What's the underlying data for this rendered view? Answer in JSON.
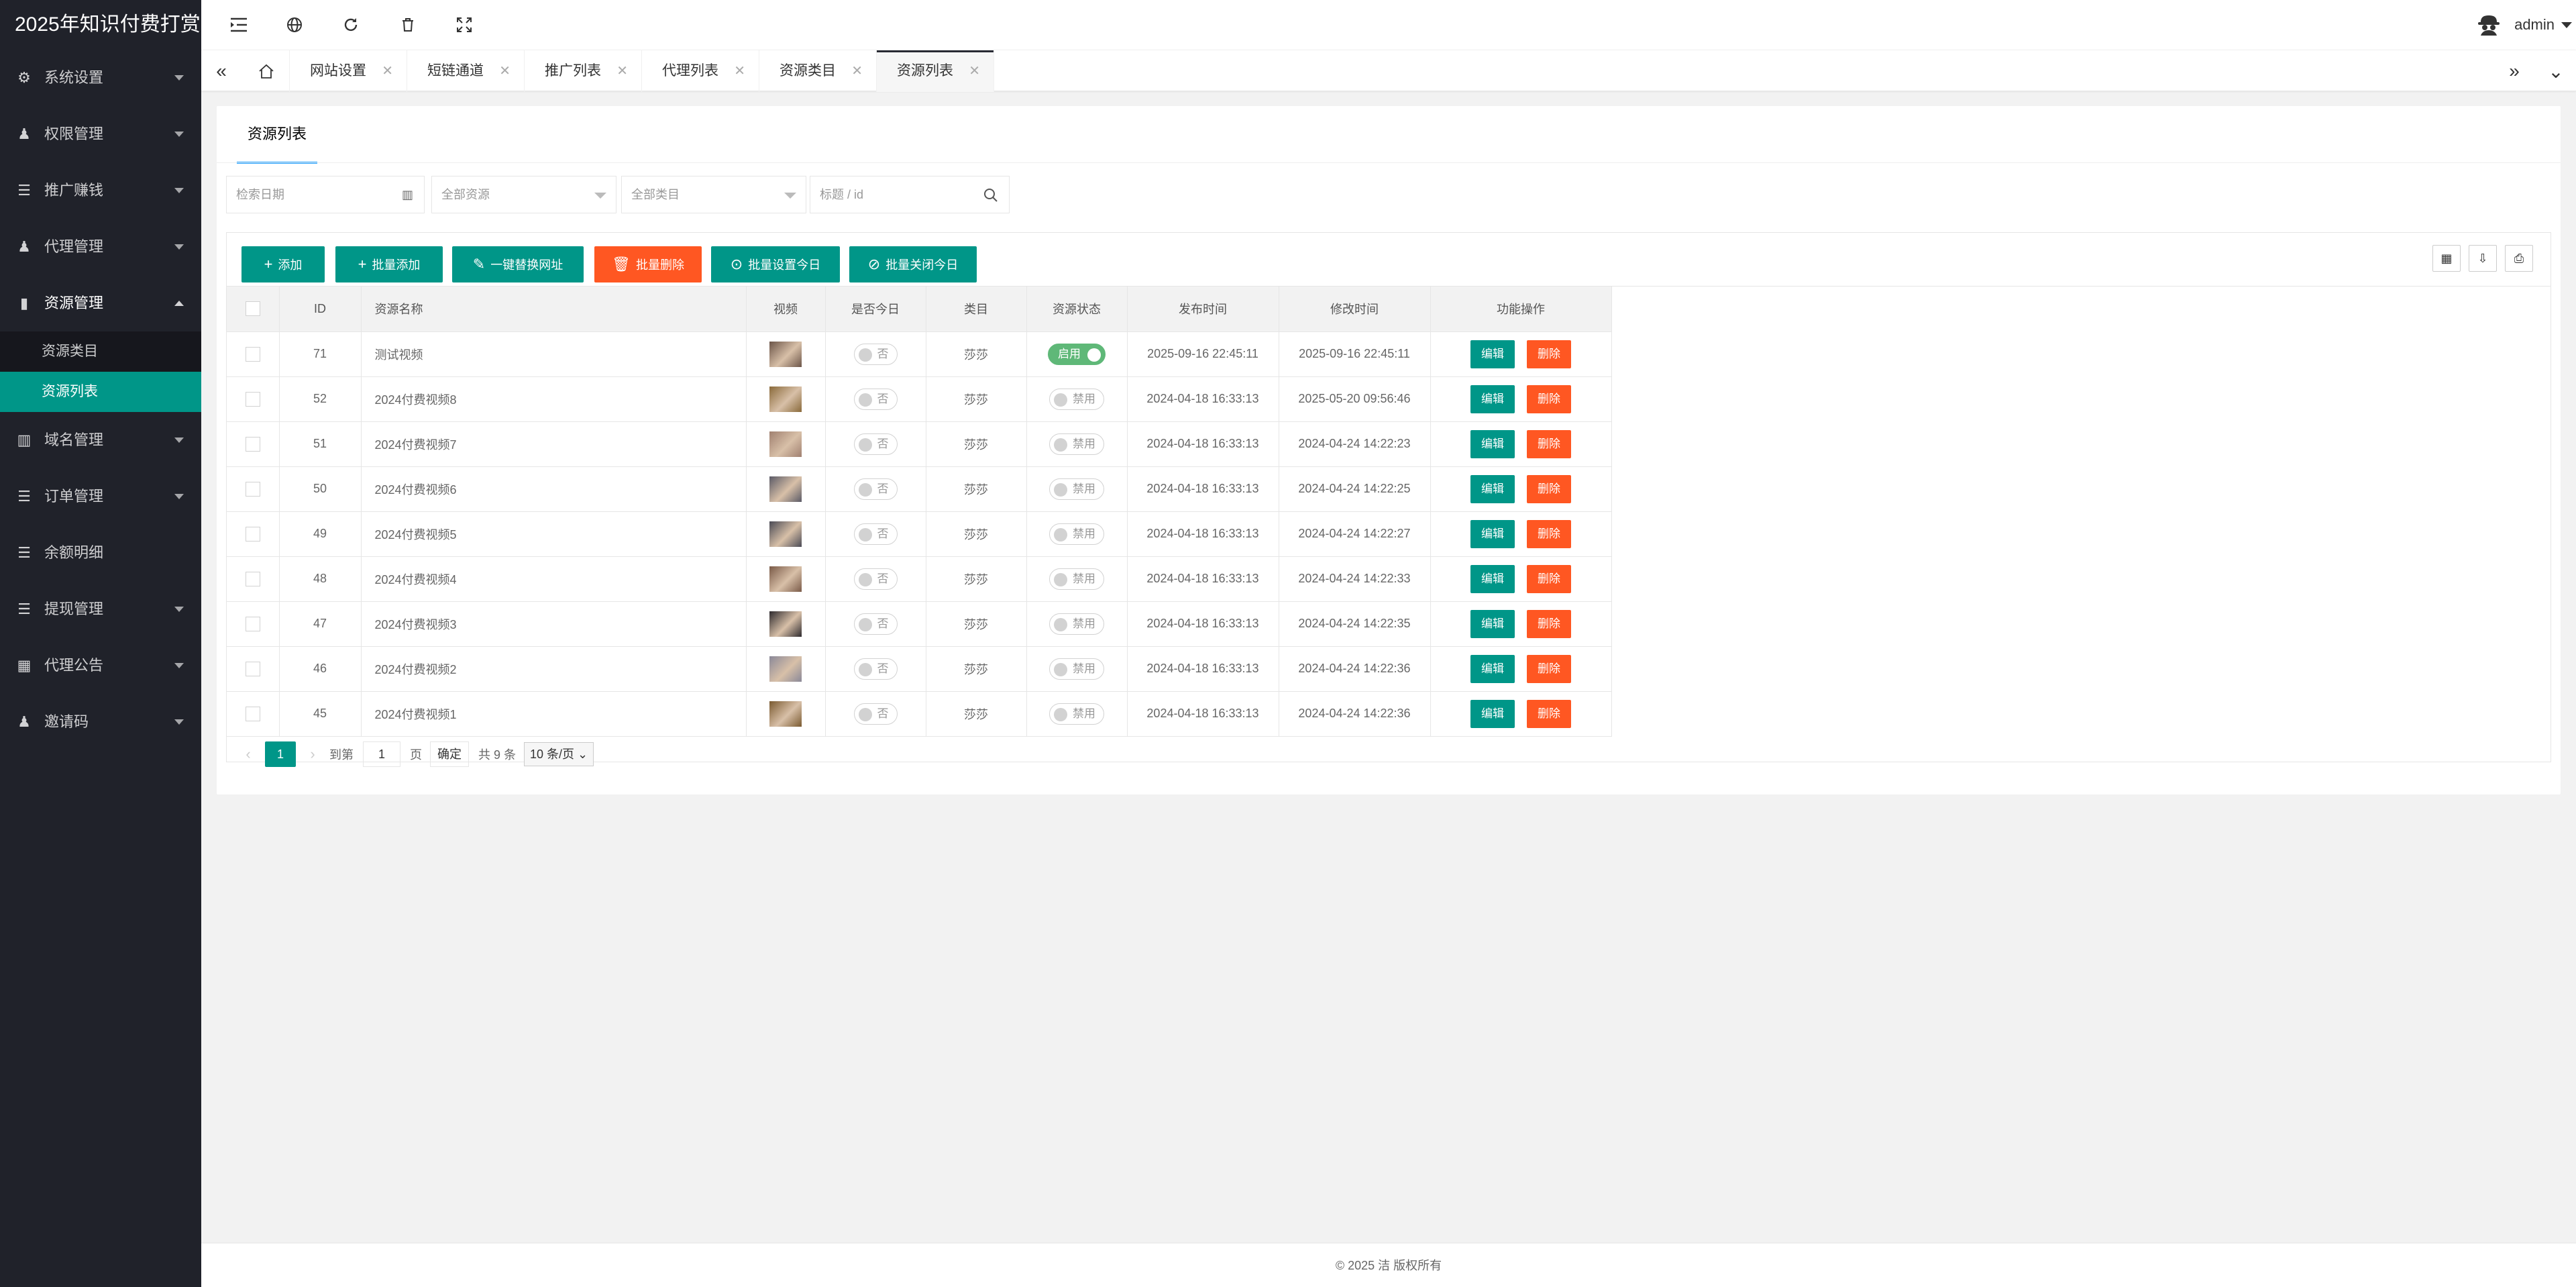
{
  "app": {
    "title": "2025年知识付费打赏"
  },
  "sidebar": {
    "items": [
      {
        "label": "系统设置",
        "icon": "gear-icon"
      },
      {
        "label": "权限管理",
        "icon": "user-key-icon"
      },
      {
        "label": "推广赚钱",
        "icon": "list-icon"
      },
      {
        "label": "代理管理",
        "icon": "user-icon"
      },
      {
        "label": "资源管理",
        "icon": "bookmark-icon",
        "open": true
      },
      {
        "label": "域名管理",
        "icon": "book-icon"
      },
      {
        "label": "订单管理",
        "icon": "list-icon"
      },
      {
        "label": "余额明细",
        "icon": "list-icon"
      },
      {
        "label": "提现管理",
        "icon": "list-icon"
      },
      {
        "label": "代理公告",
        "icon": "grid-icon"
      },
      {
        "label": "邀请码",
        "icon": "user-key-icon"
      }
    ],
    "submenu": [
      {
        "label": "资源类目"
      },
      {
        "label": "资源列表",
        "active": true
      }
    ]
  },
  "header": {
    "icons": [
      "menu-fold-icon",
      "globe-icon",
      "refresh-icon",
      "trash-icon",
      "fullscreen-icon"
    ],
    "user": "admin"
  },
  "tabs": [
    {
      "label": "网站设置"
    },
    {
      "label": "短链通道"
    },
    {
      "label": "推广列表"
    },
    {
      "label": "代理列表"
    },
    {
      "label": "资源类目"
    },
    {
      "label": "资源列表",
      "active": true
    }
  ],
  "card": {
    "title": "资源列表",
    "filters": {
      "date_placeholder": "检索日期",
      "resource_select": "全部资源",
      "category_select": "全部类目",
      "search_placeholder": "标题 / id"
    },
    "toolbar": {
      "add": "添加",
      "batch_add": "批量添加",
      "replace_url": "一键替换网址",
      "batch_delete": "批量删除",
      "batch_set_today": "批量设置今日",
      "batch_close_today": "批量关闭今日"
    },
    "columns": {
      "id": "ID",
      "name": "资源名称",
      "video": "视频",
      "today": "是否今日",
      "category": "类目",
      "status": "资源状态",
      "publish": "发布时间",
      "modify": "修改时间",
      "ops": "功能操作"
    },
    "actions": {
      "edit": "编辑",
      "delete": "删除"
    },
    "rows": [
      {
        "id": "71",
        "name": "测试视频",
        "today": "否",
        "category": "莎莎",
        "status": "启用",
        "status_on": true,
        "publish": "2025-09-16 22:45:11",
        "modify": "2025-09-16 22:45:11",
        "thumb": "#6b5448"
      },
      {
        "id": "52",
        "name": "2024付费视频8",
        "today": "否",
        "category": "莎莎",
        "status": "禁用",
        "status_on": false,
        "publish": "2024-04-18 16:33:13",
        "modify": "2025-05-20 09:56:46",
        "thumb": "#8a6a3a"
      },
      {
        "id": "51",
        "name": "2024付费视频7",
        "today": "否",
        "category": "莎莎",
        "status": "禁用",
        "status_on": false,
        "publish": "2024-04-18 16:33:13",
        "modify": "2024-04-24 14:22:23",
        "thumb": "#a08070"
      },
      {
        "id": "50",
        "name": "2024付费视频6",
        "today": "否",
        "category": "莎莎",
        "status": "禁用",
        "status_on": false,
        "publish": "2024-04-18 16:33:13",
        "modify": "2024-04-24 14:22:25",
        "thumb": "#5a5a66"
      },
      {
        "id": "49",
        "name": "2024付费视频5",
        "today": "否",
        "category": "莎莎",
        "status": "禁用",
        "status_on": false,
        "publish": "2024-04-18 16:33:13",
        "modify": "2024-04-24 14:22:27",
        "thumb": "#4a4a55"
      },
      {
        "id": "48",
        "name": "2024付费视频4",
        "today": "否",
        "category": "莎莎",
        "status": "禁用",
        "status_on": false,
        "publish": "2024-04-18 16:33:13",
        "modify": "2024-04-24 14:22:33",
        "thumb": "#7a5a48"
      },
      {
        "id": "47",
        "name": "2024付费视频3",
        "today": "否",
        "category": "莎莎",
        "status": "禁用",
        "status_on": false,
        "publish": "2024-04-18 16:33:13",
        "modify": "2024-04-24 14:22:35",
        "thumb": "#2e2a2e"
      },
      {
        "id": "46",
        "name": "2024付费视频2",
        "today": "否",
        "category": "莎莎",
        "status": "禁用",
        "status_on": false,
        "publish": "2024-04-18 16:33:13",
        "modify": "2024-04-24 14:22:36",
        "thumb": "#8a8898"
      },
      {
        "id": "45",
        "name": "2024付费视频1",
        "today": "否",
        "category": "莎莎",
        "status": "禁用",
        "status_on": false,
        "publish": "2024-04-18 16:33:13",
        "modify": "2024-04-24 14:22:36",
        "thumb": "#7a5a30"
      }
    ],
    "pagination": {
      "current": "1",
      "goto_label": "到第",
      "page_input": "1",
      "page_unit": "页",
      "confirm": "确定",
      "total": "共 9 条",
      "page_size": "10 条/页"
    }
  },
  "footer": {
    "text": "© 2025 洁 版权所有"
  },
  "colors": {
    "sidebar": "#20222a",
    "primary": "#009688",
    "danger": "#ff5722",
    "switch_on": "#5fb878"
  }
}
